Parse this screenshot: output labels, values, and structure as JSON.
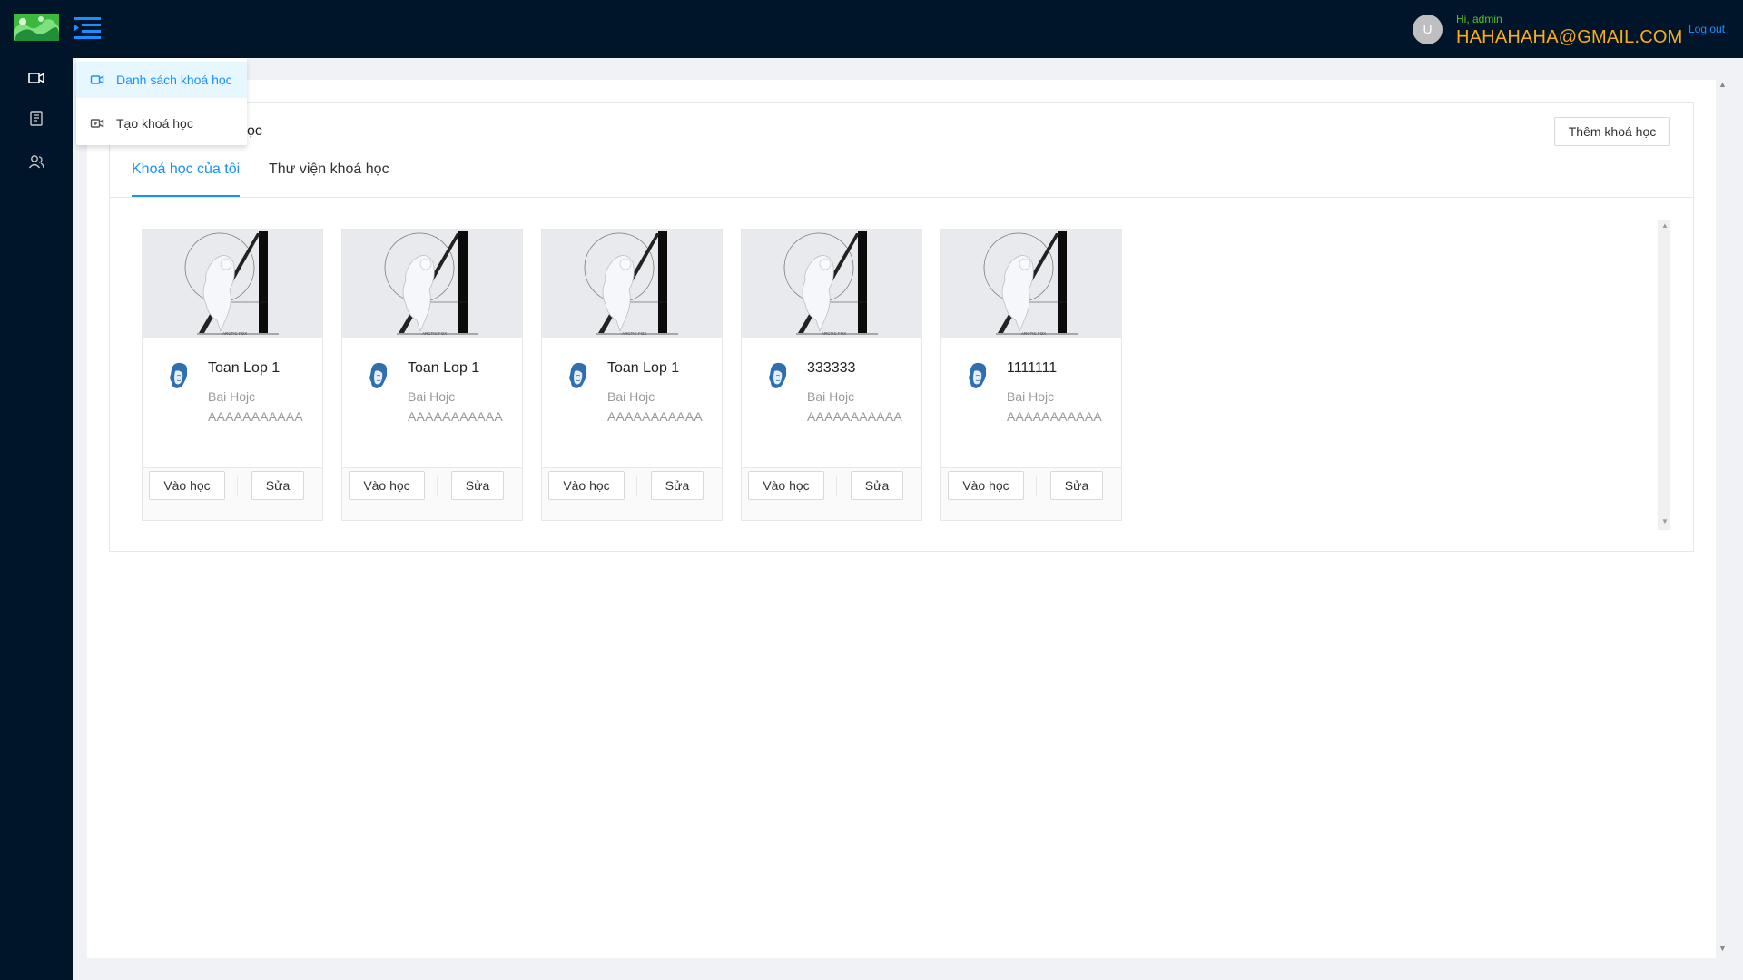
{
  "header": {
    "greeting": "Hi, admin",
    "email": "HAHAHAHA@GMAIL.COM",
    "avatar_initial": "U",
    "logout_label": "Log out",
    "colors": {
      "bg": "#001529",
      "greeting": "#52c41a",
      "email": "#faad14",
      "link": "#1890ff"
    }
  },
  "sidebar": {
    "icons": [
      "video-icon",
      "document-list-icon",
      "users-icon"
    ]
  },
  "dropdown": {
    "items": [
      {
        "label": "Danh sách khoá học",
        "icon": "video-icon",
        "active": true
      },
      {
        "label": "Tạo khoá học",
        "icon": "video-add-icon",
        "active": false
      }
    ]
  },
  "panel": {
    "title_visible": "ọc",
    "add_button": "Thêm khoá học",
    "tabs": [
      {
        "label": "Khoá học của tôi",
        "active": true
      },
      {
        "label": "Thư viện khoá học",
        "active": false
      }
    ]
  },
  "courses": [
    {
      "title": "Toan Lop 1",
      "line1": "Bai Hojc",
      "line2": "AAAAAAAAAAA",
      "learn": "Vào học",
      "edit": "Sửa"
    },
    {
      "title": "Toan Lop 1",
      "line1": "Bai Hojc",
      "line2": "AAAAAAAAAAA",
      "learn": "Vào học",
      "edit": "Sửa"
    },
    {
      "title": "Toan Lop 1",
      "line1": "Bai Hojc",
      "line2": "AAAAAAAAAAA",
      "learn": "Vào học",
      "edit": "Sửa"
    },
    {
      "title": "333333",
      "line1": "Bai Hojc",
      "line2": "AAAAAAAAAAA",
      "learn": "Vào học",
      "edit": "Sửa"
    },
    {
      "title": "1111111",
      "line1": "Bai Hojc",
      "line2": "AAAAAAAAAAA",
      "learn": "Vào học",
      "edit": "Sửa"
    }
  ],
  "cover_caption": "ARCTIC FOX"
}
